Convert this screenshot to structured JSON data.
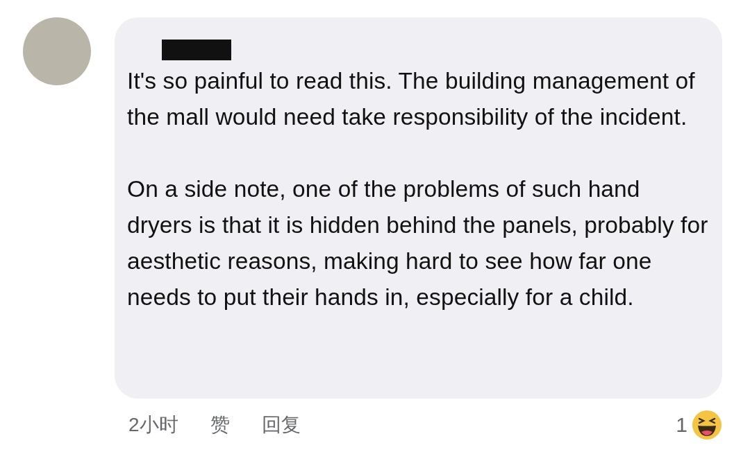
{
  "comment": {
    "paragraphs": [
      "It's so painful to read this. The building management of the mall would need take responsibility of the incident.",
      "On a side note, one of the problems of such hand dryers is that it is hidden behind the panels, probably for aesthetic reasons, making hard to see how far one needs to put their hands in, especially for a child."
    ],
    "time": "2小时",
    "actions": [
      "赞",
      "回复"
    ],
    "reaction_count": "1"
  }
}
